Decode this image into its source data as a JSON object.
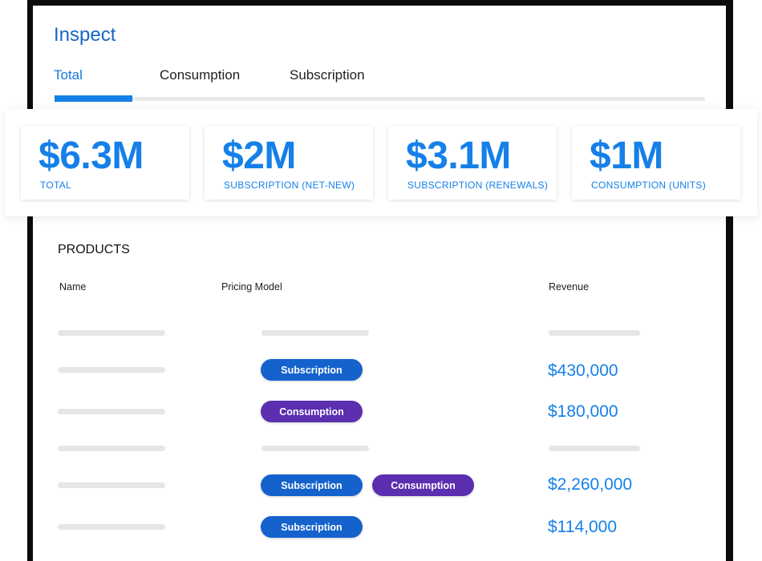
{
  "header": {
    "title": "Inspect"
  },
  "tabs": [
    {
      "label": "Total",
      "active": true
    },
    {
      "label": "Consumption",
      "active": false
    },
    {
      "label": "Subscription",
      "active": false
    }
  ],
  "stats": [
    {
      "value": "$6.3M",
      "label": "TOTAL"
    },
    {
      "value": "$2M",
      "label": "SUBSCRIPTION (NET-NEW)"
    },
    {
      "value": "$3.1M",
      "label": "SUBSCRIPTION (RENEWALS)"
    },
    {
      "value": "$1M",
      "label": "CONSUMPTION (UNITS)"
    }
  ],
  "products": {
    "title": "PRODUCTS",
    "columns": [
      "Name",
      "Pricing Model",
      "Revenue"
    ],
    "rows": [
      {
        "pricing": [],
        "revenue": ""
      },
      {
        "pricing": [
          "Subscription"
        ],
        "revenue": "$430,000"
      },
      {
        "pricing": [
          "Consumption"
        ],
        "revenue": "$180,000"
      },
      {
        "pricing": [],
        "revenue": ""
      },
      {
        "pricing": [
          "Subscription",
          "Consumption"
        ],
        "revenue": "$2,260,000"
      },
      {
        "pricing": [
          "Subscription"
        ],
        "revenue": "$114,000"
      }
    ]
  },
  "colors": {
    "accent": "#1580e8",
    "title": "#1666c4",
    "subscription_pill": "#1562cc",
    "consumption_pill": "#5b2fb0"
  }
}
